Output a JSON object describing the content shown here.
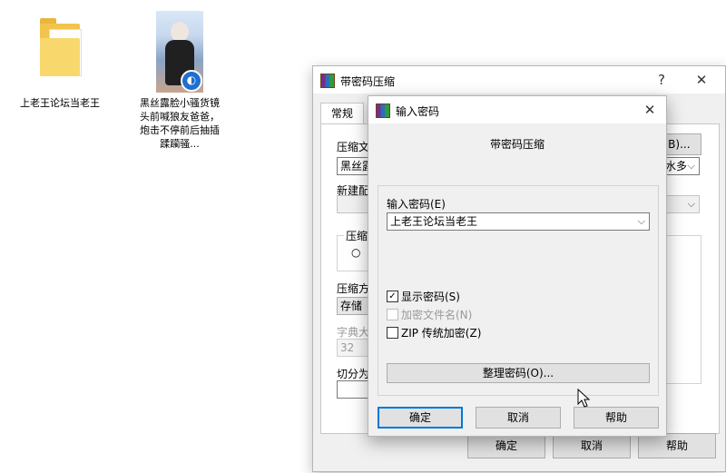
{
  "desktop": {
    "icons": [
      {
        "label": "上老王论坛当老王"
      },
      {
        "label": "黑丝露脸小骚货镜头前喊狼友爸爸，炮击不停前后抽插蹂躏骚..."
      }
    ]
  },
  "back_dialog": {
    "title": "带密码压缩",
    "help_glyph": "?",
    "close_glyph": "✕",
    "tab_general": "常规",
    "archive_label": "压缩文",
    "archive_value": "黑丝露",
    "browse_label": "(B)...",
    "update_mode_value": "水多",
    "new_config_label": "新建配",
    "compress_group_label": "压缩",
    "radio_label": "○",
    "method_label": "压缩方",
    "method_value": "存储",
    "dict_label": "字典大",
    "dict_value": "32",
    "split_label": "切分为",
    "ok": "确定",
    "cancel": "取消",
    "help": "帮助"
  },
  "front_dialog": {
    "title": "输入密码",
    "close_glyph": "✕",
    "subtitle": "带密码压缩",
    "password_label": "输入密码(E)",
    "password_value": "上老王论坛当老王",
    "show_password": {
      "label": "显示密码(S)",
      "checked": true
    },
    "encrypt_names": {
      "label": "加密文件名(N)",
      "checked": false,
      "disabled": true
    },
    "zip_legacy": {
      "label": "ZIP 传统加密(Z)",
      "checked": false
    },
    "organize_button": "整理密码(O)...",
    "ok": "确定",
    "cancel": "取消",
    "help": "帮助"
  }
}
